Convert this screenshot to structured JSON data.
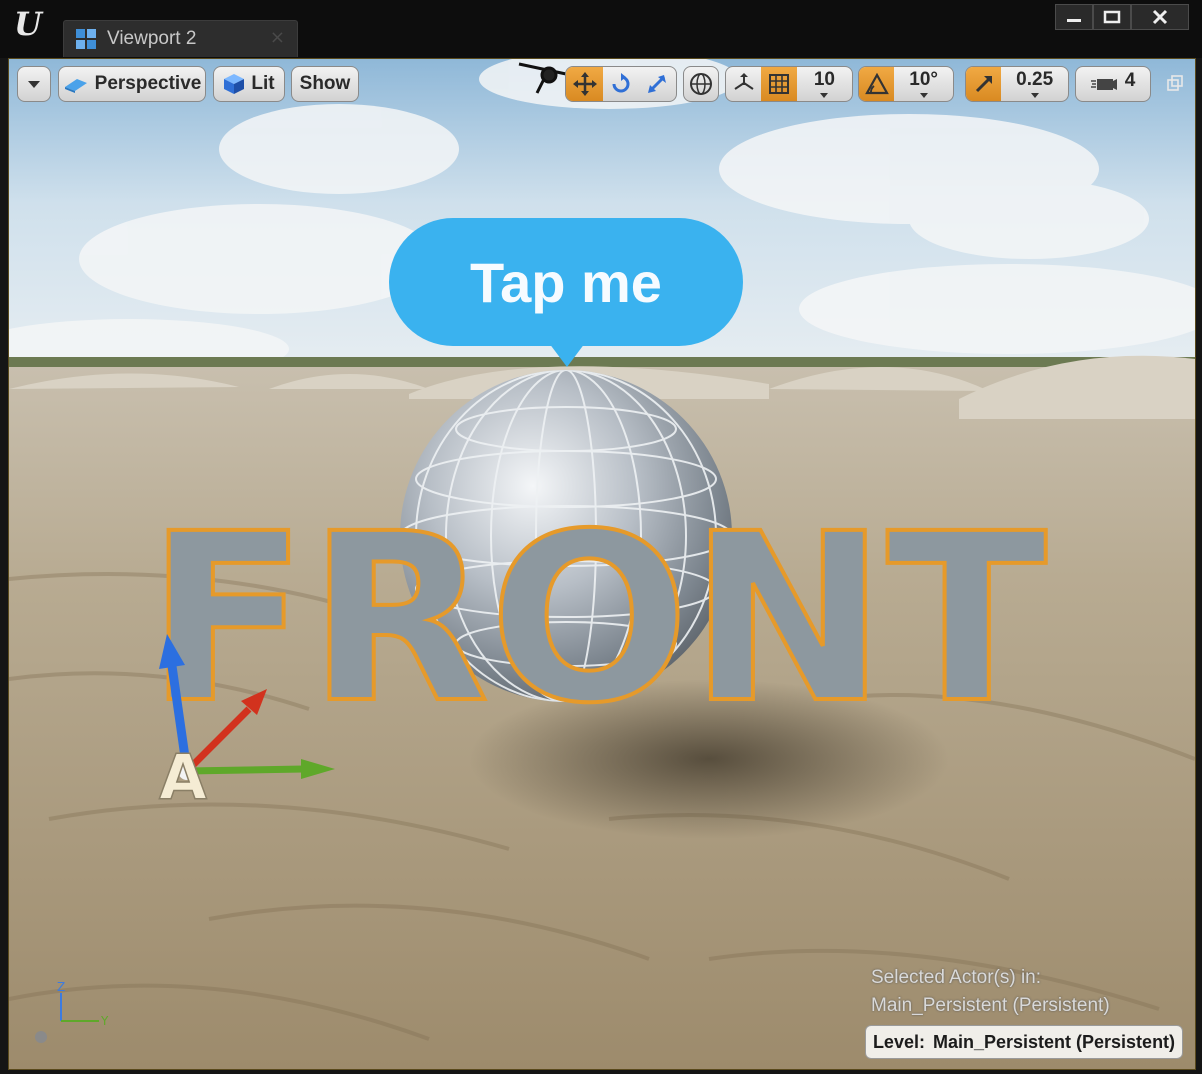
{
  "window": {
    "tab_title": "Viewport 2",
    "tab_close_glyph": "×",
    "logo_text": "U",
    "controls": [
      "minimize-icon",
      "maximize-icon",
      "close-icon"
    ]
  },
  "toolbar": {
    "options_icon": "chevron-down-icon",
    "view_mode_label": "Perspective",
    "lighting_label": "Lit",
    "show_label": "Show",
    "grid_snap_value": "10",
    "rotation_snap_value": "10°",
    "scale_snap_value": "0.25",
    "camera_speed_value": "4"
  },
  "scene": {
    "bubble_text": "Tap me",
    "text_3d": "FRONT",
    "gizmo_label": "A"
  },
  "status": {
    "selected_line1": "Selected Actor(s) in:",
    "selected_line2": "Main_Persistent (Persistent)",
    "level_prefix": "Level:",
    "level_value": "Main_Persistent (Persistent)"
  },
  "axis_indicator": {
    "z": "Z",
    "y": "Y"
  },
  "colors": {
    "accent_orange": "#e89a30",
    "bubble_blue": "#3ab2ef",
    "axis_x_red": "#d2321e",
    "axis_y_green": "#5fa82a",
    "axis_z_blue": "#2c6fe0"
  }
}
